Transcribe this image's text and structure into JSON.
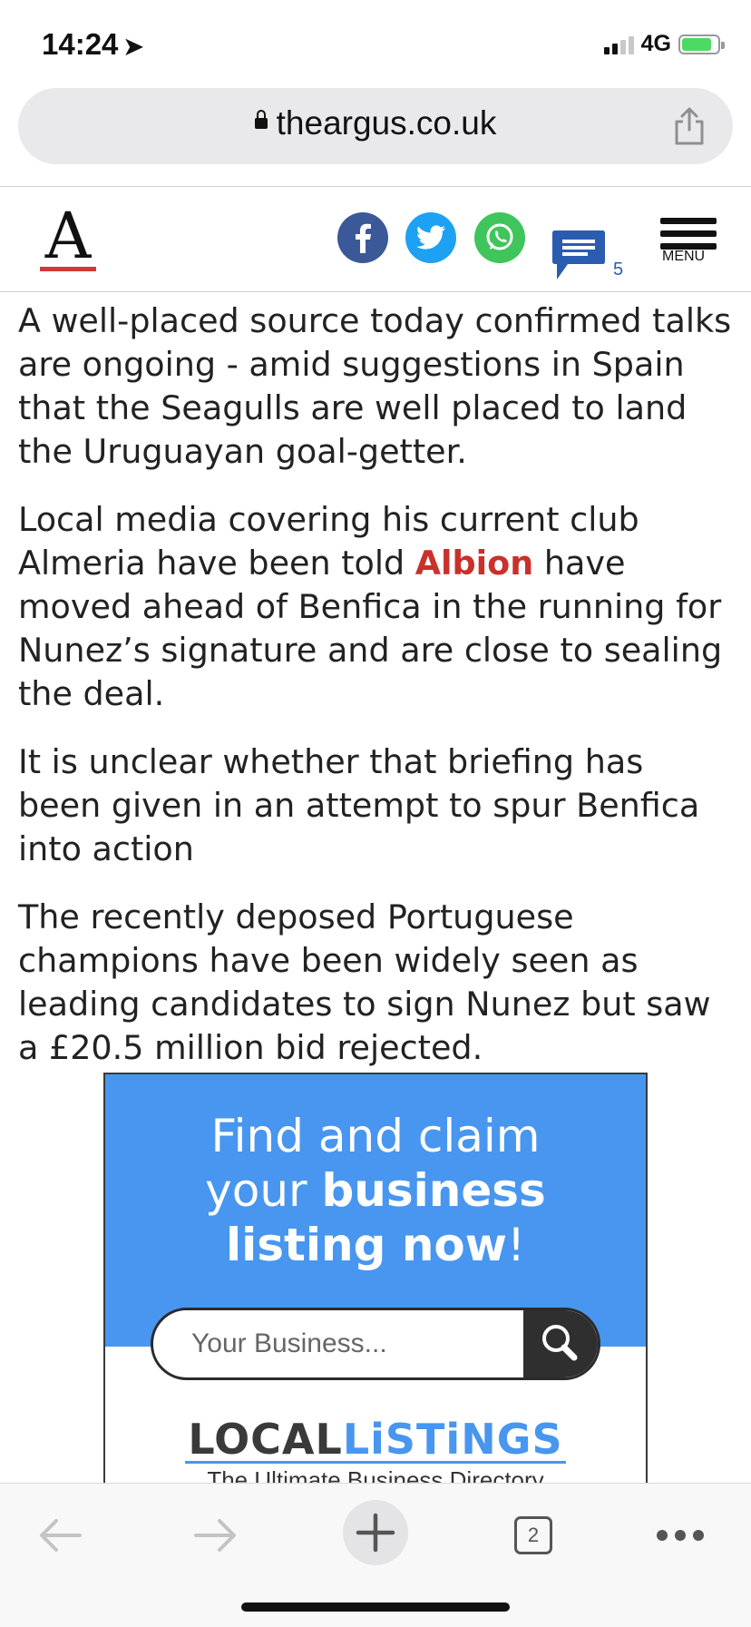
{
  "status_bar": {
    "time": "14:24",
    "network": "4G"
  },
  "url_bar": {
    "domain": "theargus.co.uk"
  },
  "site_header": {
    "logo_letter": "A",
    "comment_count": "5",
    "menu_label": "MENU"
  },
  "article": {
    "paragraphs": [
      "A well-placed source today confirmed talks are ongoing - amid suggestions in Spain that the Seagulls are well placed to land the Uruguayan goal-getter.",
      "",
      "It is unclear whether that briefing has been given in an attempt to spur Benfica into action",
      "The recently deposed Portuguese champions have been widely seen as leading candidates to sign Nunez but saw a £20.5 million bid rejected."
    ],
    "para2_before": "Local media covering his current club Almeria have been told ",
    "para2_link": "Albion",
    "para2_after": " have moved ahead of Benfica in the running for Nunez’s signature and are close to sealing the deal."
  },
  "ad": {
    "headline_line1": "Find and claim",
    "headline_line2_normal": "your ",
    "headline_line2_bold": "business",
    "headline_line3_bold": "listing now",
    "headline_line3_end": "!",
    "search_placeholder": "Your Business...",
    "brand_part1": "LOCAL",
    "brand_part2": "LiSTiNGS",
    "tagline": "The Ultimate Business Directory"
  },
  "toolbar": {
    "tab_count": "2"
  },
  "colors": {
    "link": "#c8312c",
    "ad_blue": "#4896ef",
    "facebook": "#3b5998",
    "twitter": "#1da1f2",
    "whatsapp": "#3fc55b"
  },
  "icons": [
    "location-arrow-icon",
    "signal-icon",
    "battery-icon",
    "lock-icon",
    "share-icon",
    "facebook-icon",
    "twitter-icon",
    "whatsapp-icon",
    "comments-icon",
    "hamburger-menu-icon",
    "search-icon",
    "back-arrow-icon",
    "forward-arrow-icon",
    "plus-icon",
    "tabs-icon",
    "more-icon"
  ]
}
